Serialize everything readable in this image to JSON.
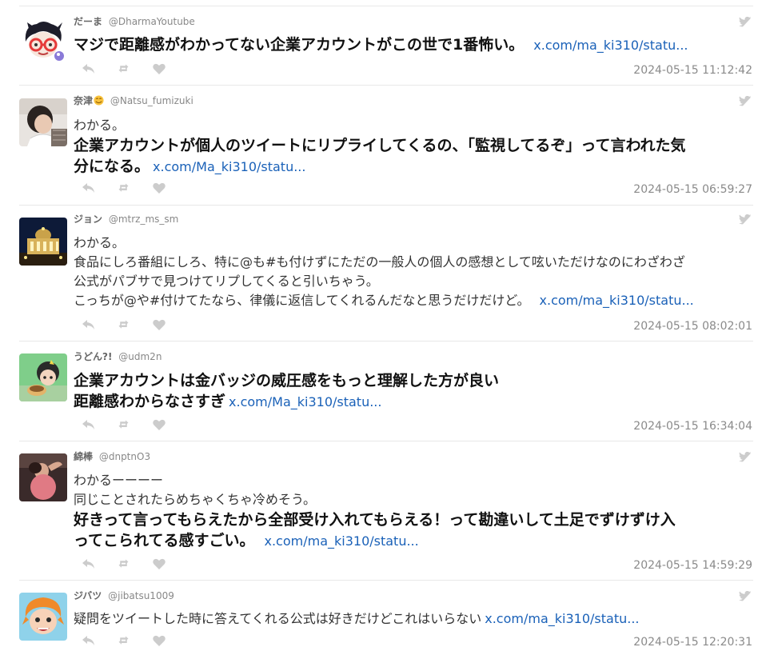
{
  "tweets": [
    {
      "name": "だーま",
      "handle": "@DharmaYoutube",
      "lines": [
        {
          "text": "マジで距離感がわかってない企業アカウントがこの世で1番怖い。",
          "style": "bold",
          "link": "x.com/ma_ki310/statu..."
        }
      ],
      "timestamp": "2024-05-15 11:12:42"
    },
    {
      "name": "奈津",
      "handle": "@Natsu_fumizuki",
      "lines": [
        {
          "text": "わかる。",
          "style": "normal"
        },
        {
          "text": "企業アカウントが個人のツイートにリプライしてくるの、「監視してるぞ」って言われた気",
          "style": "bold"
        },
        {
          "text": "分になる。",
          "style": "bold",
          "link": "x.com/Ma_ki310/statu..."
        }
      ],
      "timestamp": "2024-05-15 06:59:27"
    },
    {
      "name": "ジョン",
      "handle": "@mtrz_ms_sm",
      "lines": [
        {
          "text": "わかる。",
          "style": "normal"
        },
        {
          "text": "食品にしろ番組にしろ、特に@も#も付けずにただの一般人の個人の感想として呟いただけなのにわざわざ",
          "style": "normal"
        },
        {
          "text": "公式がパブサで見つけてリプしてくると引いちゃう。",
          "style": "normal"
        },
        {
          "text": "こっちが@や#付けてたなら、律儀に返信してくれるんだなと思うだけだけど。",
          "style": "normal",
          "link": "x.com/ma_ki310/statu..."
        }
      ],
      "timestamp": "2024-05-15 08:02:01"
    },
    {
      "name": "うどん?!",
      "handle": "@udm2n",
      "lines": [
        {
          "text": "企業アカウントは金バッジの威圧感をもっと理解した方が良い",
          "style": "bold"
        },
        {
          "text": "距離感わからなさすぎ",
          "style": "bold",
          "link": "x.com/Ma_ki310/statu..."
        }
      ],
      "timestamp": "2024-05-15 16:34:04"
    },
    {
      "name": "綿棒",
      "handle": "@dnptnO3",
      "lines": [
        {
          "text": "わかるーーーー",
          "style": "normal"
        },
        {
          "text": "同じことされたらめちゃくちゃ冷めそう。",
          "style": "normal"
        },
        {
          "text": "好きって言ってもらえたから全部受け入れてもらえる！って勘違いして土足でずけずけ入",
          "style": "bold"
        },
        {
          "text": "ってこられてる感すごい。",
          "style": "bold",
          "link": "x.com/ma_ki310/statu..."
        }
      ],
      "timestamp": "2024-05-15 14:59:29"
    },
    {
      "name": "ジバツ",
      "handle": "@jibatsu1009",
      "lines": [
        {
          "text": "疑問をツイートした時に答えてくれる公式は好きだけどこれはいらない",
          "style": "normal",
          "link": "x.com/ma_ki310/statu..."
        }
      ],
      "timestamp": "2024-05-15 12:20:31"
    }
  ],
  "icons": {
    "service": "twitter-bird-icon",
    "reply": "reply-icon",
    "retweet": "retweet-icon",
    "like": "heart-icon",
    "name_emoji": "smiling-face-emoji-icon"
  },
  "colors": {
    "link": "#1a61b8",
    "icon_gray": "#cccccc",
    "timestamp": "#8a8a8a",
    "divider": "#e8e8e8"
  }
}
